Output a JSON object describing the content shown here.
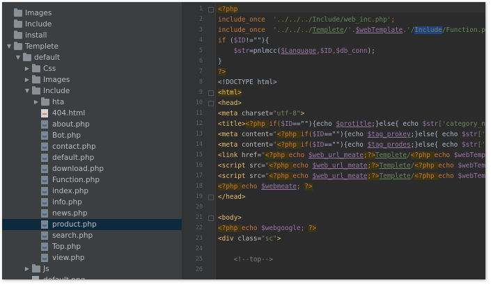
{
  "project_tree": {
    "items": [
      {
        "label": "Images",
        "kind": "folder",
        "indent": 0,
        "arrow": ""
      },
      {
        "label": "Include",
        "kind": "folder",
        "indent": 0,
        "arrow": ""
      },
      {
        "label": "install",
        "kind": "folder",
        "indent": 0,
        "arrow": ""
      },
      {
        "label": "Templete",
        "kind": "folder",
        "indent": 0,
        "arrow": "▼"
      },
      {
        "label": "default",
        "kind": "folder",
        "indent": 1,
        "arrow": "▼"
      },
      {
        "label": "Css",
        "kind": "folder",
        "indent": 2,
        "arrow": "▶"
      },
      {
        "label": "Images",
        "kind": "folder",
        "indent": 2,
        "arrow": "▶"
      },
      {
        "label": "Include",
        "kind": "folder",
        "indent": 2,
        "arrow": "▼"
      },
      {
        "label": "hta",
        "kind": "folder",
        "indent": 3,
        "arrow": "▶"
      },
      {
        "label": "404.html",
        "kind": "html",
        "indent": 3,
        "arrow": ""
      },
      {
        "label": "about.php",
        "kind": "php",
        "indent": 3,
        "arrow": ""
      },
      {
        "label": "Bot.php",
        "kind": "php",
        "indent": 3,
        "arrow": ""
      },
      {
        "label": "contact.php",
        "kind": "php",
        "indent": 3,
        "arrow": ""
      },
      {
        "label": "default.php",
        "kind": "php",
        "indent": 3,
        "arrow": ""
      },
      {
        "label": "download.php",
        "kind": "php",
        "indent": 3,
        "arrow": ""
      },
      {
        "label": "Function.php",
        "kind": "php",
        "indent": 3,
        "arrow": ""
      },
      {
        "label": "index.php",
        "kind": "php",
        "indent": 3,
        "arrow": ""
      },
      {
        "label": "info.php",
        "kind": "php",
        "indent": 3,
        "arrow": ""
      },
      {
        "label": "news.php",
        "kind": "php",
        "indent": 3,
        "arrow": ""
      },
      {
        "label": "product.php",
        "kind": "php",
        "indent": 3,
        "arrow": "",
        "selected": true
      },
      {
        "label": "search.php",
        "kind": "php",
        "indent": 3,
        "arrow": ""
      },
      {
        "label": "Top.php",
        "kind": "php",
        "indent": 3,
        "arrow": ""
      },
      {
        "label": "view.php",
        "kind": "php",
        "indent": 3,
        "arrow": ""
      },
      {
        "label": "Js",
        "kind": "folder",
        "indent": 2,
        "arrow": "▶"
      },
      {
        "label": "default.png",
        "kind": "image",
        "indent": 2,
        "arrow": ""
      }
    ]
  },
  "editor": {
    "line_numbers": [
      "1",
      "2",
      "3",
      "4",
      "5",
      "6",
      "7",
      "8",
      "9",
      "10",
      "11",
      "12",
      "13",
      "14",
      "15",
      "16",
      "17",
      "18",
      "19",
      "20",
      "21",
      "22",
      "23",
      "24",
      "25",
      "26"
    ],
    "lines": [
      [
        {
          "t": "<?php",
          "c": "phpm"
        }
      ],
      [
        {
          "t": "include_once  ",
          "c": "kw"
        },
        {
          "t": "'../../../Include/web_inc.php'",
          "c": "str"
        },
        {
          "t": ";",
          "c": "kw"
        }
      ],
      [
        {
          "t": "include_once  ",
          "c": "kw"
        },
        {
          "t": "'../../../",
          "c": "str"
        },
        {
          "t": "Templete",
          "c": "str uline"
        },
        {
          "t": "/'",
          "c": "str"
        },
        {
          "t": ".",
          "c": "kw"
        },
        {
          "t": "$webTemplate",
          "c": "var uline"
        },
        {
          "t": ".",
          "c": "kw"
        },
        {
          "t": "'/",
          "c": "str"
        },
        {
          "t": "Include",
          "c": "str sel"
        },
        {
          "t": "/Function.php'",
          "c": "str"
        },
        {
          "t": ";",
          "c": "kw"
        }
      ],
      [
        {
          "t": "if ",
          "c": "kw"
        },
        {
          "t": "(",
          "c": ""
        },
        {
          "t": "$ID",
          "c": "var"
        },
        {
          "t": "!=\"\"){",
          "c": ""
        }
      ],
      [
        {
          "t": "    ",
          "c": ""
        },
        {
          "t": "$str",
          "c": "var"
        },
        {
          "t": "=pnlmcc(",
          "c": ""
        },
        {
          "t": "$Language",
          "c": "var uline"
        },
        {
          "t": ",",
          "c": "kw"
        },
        {
          "t": "$ID",
          "c": "var"
        },
        {
          "t": ",",
          "c": "kw"
        },
        {
          "t": "$db_conn",
          "c": "var"
        },
        {
          "t": ");",
          "c": ""
        }
      ],
      [
        {
          "t": "}",
          "c": ""
        }
      ],
      [
        {
          "t": "?>",
          "c": "phpm"
        }
      ],
      [
        {
          "t": "<!DOCTYPE html>",
          "c": ""
        }
      ],
      [
        {
          "t": "<html>",
          "c": "tag hl"
        }
      ],
      [
        {
          "t": "<head>",
          "c": "tag"
        }
      ],
      [
        {
          "t": "<meta ",
          "c": "tag"
        },
        {
          "t": "charset=",
          "c": "attr"
        },
        {
          "t": "\"utf-8\"",
          "c": "str"
        },
        {
          "t": ">",
          "c": "tag"
        }
      ],
      [
        {
          "t": "<title>",
          "c": "tag"
        },
        {
          "t": "<?php ",
          "c": "phpm"
        },
        {
          "t": "if(",
          "c": "kw"
        },
        {
          "t": "$ID",
          "c": "var"
        },
        {
          "t": "==\"\"){echo ",
          "c": ""
        },
        {
          "t": "$protitle",
          "c": "var uline"
        },
        {
          "t": ";}else{ echo ",
          "c": ""
        },
        {
          "t": "$str",
          "c": "var"
        },
        {
          "t": "['category_name",
          "c": "str"
        }
      ],
      [
        {
          "t": "<meta ",
          "c": "tag"
        },
        {
          "t": "content=",
          "c": "attr"
        },
        {
          "t": "\"",
          "c": "str"
        },
        {
          "t": "<?php ",
          "c": "phpm"
        },
        {
          "t": "if(",
          "c": "kw"
        },
        {
          "t": "$ID",
          "c": "var"
        },
        {
          "t": "==\"\"){echo ",
          "c": ""
        },
        {
          "t": "$tag_prokey",
          "c": "var uline"
        },
        {
          "t": ";}else{ echo ",
          "c": ""
        },
        {
          "t": "$str",
          "c": "var"
        },
        {
          "t": "['cat",
          "c": "str"
        }
      ],
      [
        {
          "t": "<meta ",
          "c": "tag"
        },
        {
          "t": "content=",
          "c": "attr"
        },
        {
          "t": "\"",
          "c": "str"
        },
        {
          "t": "<?php ",
          "c": "phpm"
        },
        {
          "t": "if(",
          "c": "kw"
        },
        {
          "t": "$ID",
          "c": "var"
        },
        {
          "t": "==\"\"){echo ",
          "c": ""
        },
        {
          "t": "$tag_prodes",
          "c": "var uline"
        },
        {
          "t": ";}else{ echo ",
          "c": ""
        },
        {
          "t": "$str",
          "c": "var"
        },
        {
          "t": "['cat",
          "c": "str"
        }
      ],
      [
        {
          "t": "<link ",
          "c": "tag"
        },
        {
          "t": "href=",
          "c": "attr"
        },
        {
          "t": "\"",
          "c": "str"
        },
        {
          "t": "<?php ",
          "c": "phpm"
        },
        {
          "t": "echo ",
          "c": "kw"
        },
        {
          "t": "$web_url_meate",
          "c": "var uline"
        },
        {
          "t": ";?>",
          "c": "phpm"
        },
        {
          "t": "Templete",
          "c": "str uline"
        },
        {
          "t": "/",
          "c": "str"
        },
        {
          "t": "<?php ",
          "c": "phpm"
        },
        {
          "t": "echo ",
          "c": "kw"
        },
        {
          "t": "$webTemplat",
          "c": "var"
        }
      ],
      [
        {
          "t": "<script ",
          "c": "tag"
        },
        {
          "t": "src=",
          "c": "attr"
        },
        {
          "t": "\"",
          "c": "str"
        },
        {
          "t": "<?php ",
          "c": "phpm"
        },
        {
          "t": "echo ",
          "c": "kw"
        },
        {
          "t": "$web_url_meate",
          "c": "var uline"
        },
        {
          "t": ";?>",
          "c": "phpm"
        },
        {
          "t": "Templete",
          "c": "str uline"
        },
        {
          "t": "/",
          "c": "str"
        },
        {
          "t": "<?php ",
          "c": "phpm"
        },
        {
          "t": "echo ",
          "c": "kw"
        },
        {
          "t": "$webTempla",
          "c": "var"
        }
      ],
      [
        {
          "t": "<script ",
          "c": "tag"
        },
        {
          "t": "src=",
          "c": "attr"
        },
        {
          "t": "\"",
          "c": "str"
        },
        {
          "t": "<?php ",
          "c": "phpm"
        },
        {
          "t": "echo ",
          "c": "kw"
        },
        {
          "t": "$web_url_meate",
          "c": "var uline"
        },
        {
          "t": ";?>",
          "c": "phpm"
        },
        {
          "t": "Templete",
          "c": "str uline"
        },
        {
          "t": "/",
          "c": "str"
        },
        {
          "t": "<?php ",
          "c": "phpm"
        },
        {
          "t": "echo ",
          "c": "kw"
        },
        {
          "t": "$webTempla",
          "c": "var"
        }
      ],
      [
        {
          "t": "<?php ",
          "c": "phpm"
        },
        {
          "t": "echo ",
          "c": "kw"
        },
        {
          "t": "$webmeate",
          "c": "var uline"
        },
        {
          "t": "; ",
          "c": "kw"
        },
        {
          "t": "?>",
          "c": "phpm"
        }
      ],
      [
        {
          "t": "</head>",
          "c": "tag"
        }
      ],
      [
        {
          "t": "",
          "c": ""
        }
      ],
      [
        {
          "t": "<body>",
          "c": "tag"
        }
      ],
      [
        {
          "t": "<?php ",
          "c": "phpm"
        },
        {
          "t": "echo ",
          "c": "kw"
        },
        {
          "t": "$webgoogle",
          "c": "var"
        },
        {
          "t": "; ",
          "c": "kw"
        },
        {
          "t": "?>",
          "c": "phpm"
        }
      ],
      [
        {
          "t": "<div ",
          "c": "tag"
        },
        {
          "t": "class=",
          "c": "attr"
        },
        {
          "t": "\"sc\"",
          "c": "str"
        },
        {
          "t": ">",
          "c": "tag"
        }
      ],
      [
        {
          "t": "",
          "c": ""
        }
      ],
      [
        {
          "t": "    <!--top-->",
          "c": "cmt"
        }
      ],
      [
        {
          "t": "",
          "c": ""
        }
      ]
    ]
  }
}
